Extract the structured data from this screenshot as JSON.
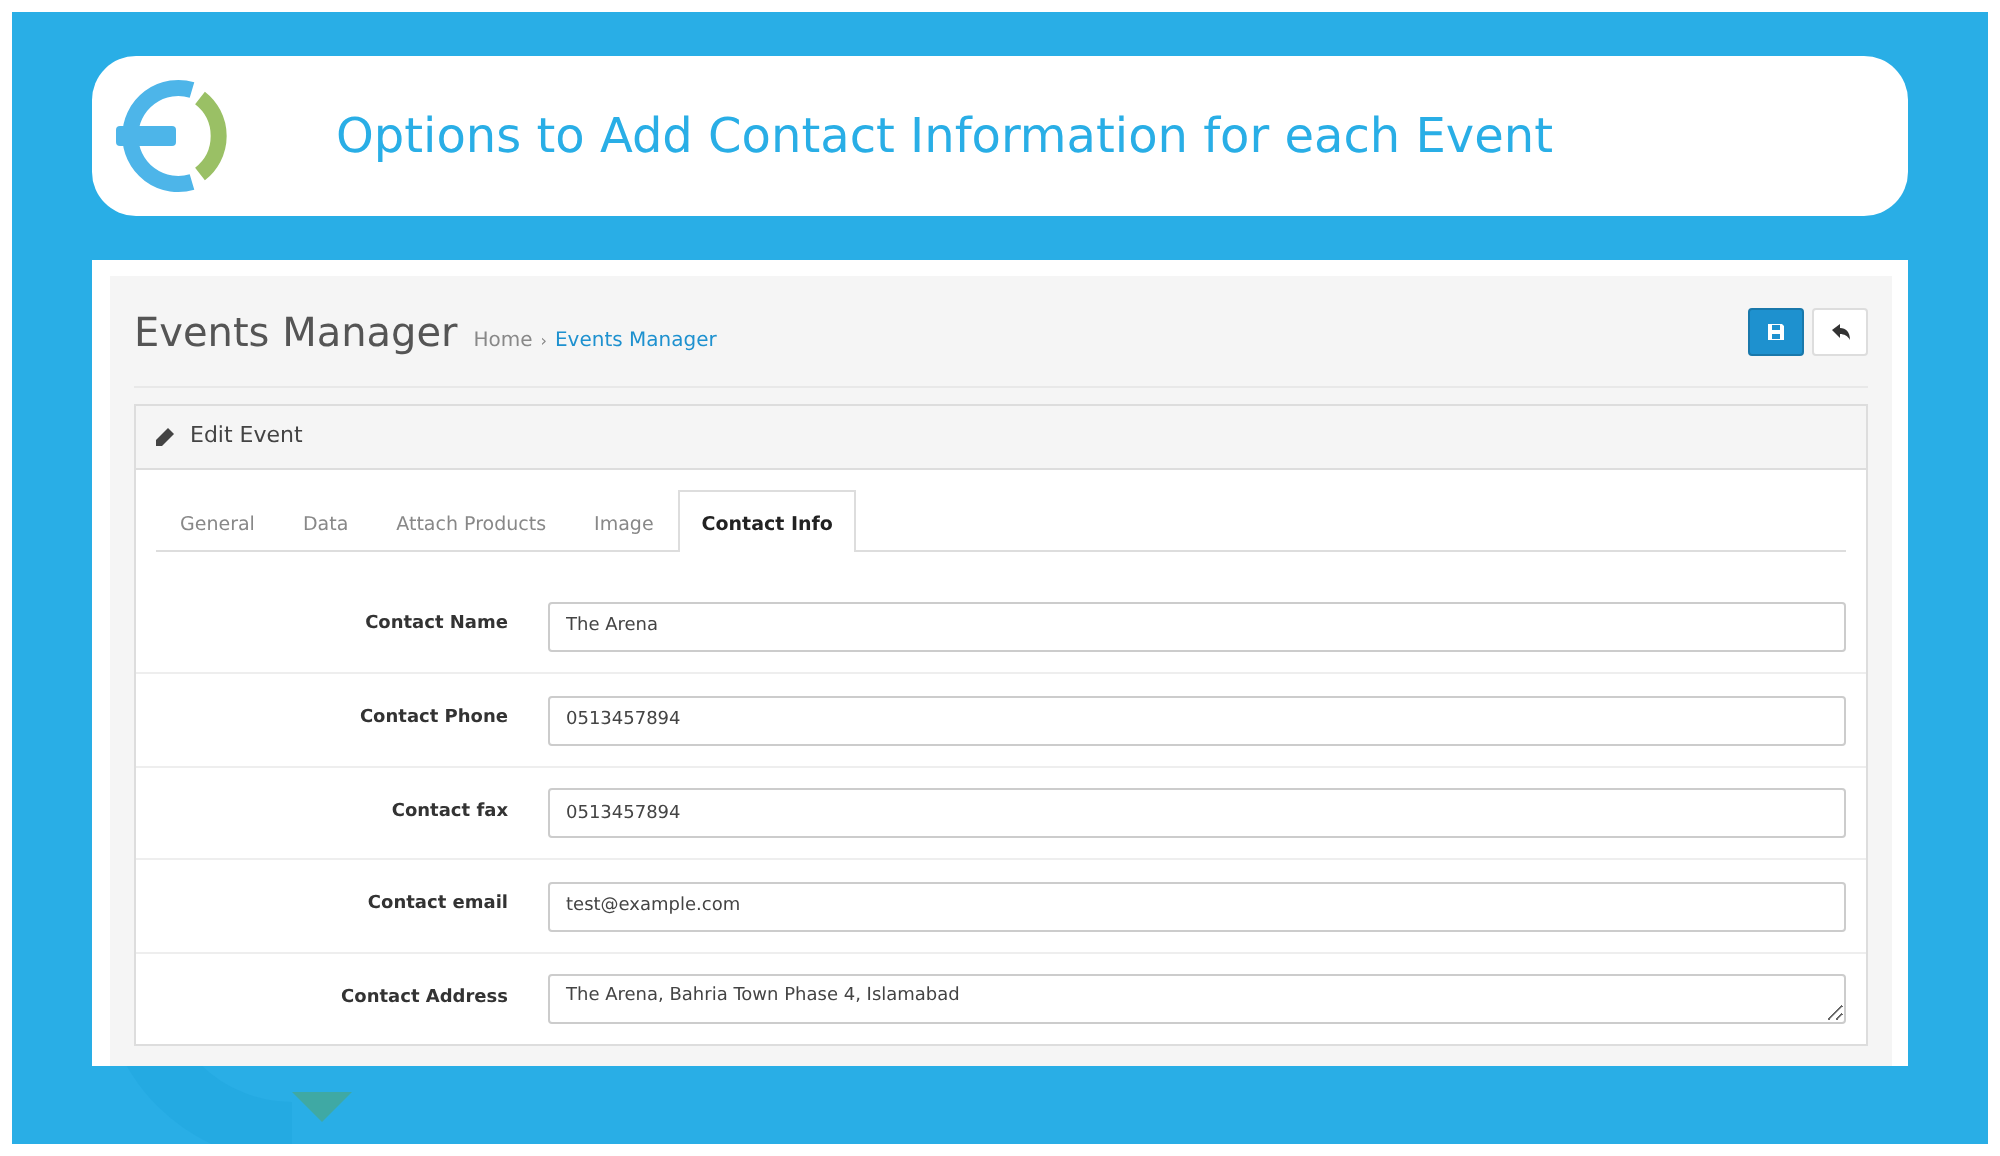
{
  "banner": {
    "title": "Options to Add Contact Information for each Event"
  },
  "page": {
    "title": "Events Manager",
    "breadcrumb": [
      {
        "label": "Home",
        "link": false
      },
      {
        "label": "Events Manager",
        "link": true
      }
    ],
    "separator": "›"
  },
  "panel": {
    "title": "Edit Event"
  },
  "tabs": [
    {
      "label": "General",
      "selected": false
    },
    {
      "label": "Data",
      "selected": false
    },
    {
      "label": "Attach Products",
      "selected": false
    },
    {
      "label": "Image",
      "selected": false
    },
    {
      "label": "Contact Info",
      "selected": true
    }
  ],
  "fields": [
    {
      "label": "Contact Name",
      "value": "The Arena",
      "kind": "input"
    },
    {
      "label": "Contact Phone",
      "value": "0513457894",
      "kind": "input"
    },
    {
      "label": "Contact fax",
      "value": "0513457894",
      "kind": "input"
    },
    {
      "label": "Contact email",
      "value": "test@example.com",
      "kind": "input"
    },
    {
      "label": "Contact Address",
      "value": "The Arena, Bahria Town Phase 4, Islamabad",
      "kind": "textarea"
    }
  ]
}
